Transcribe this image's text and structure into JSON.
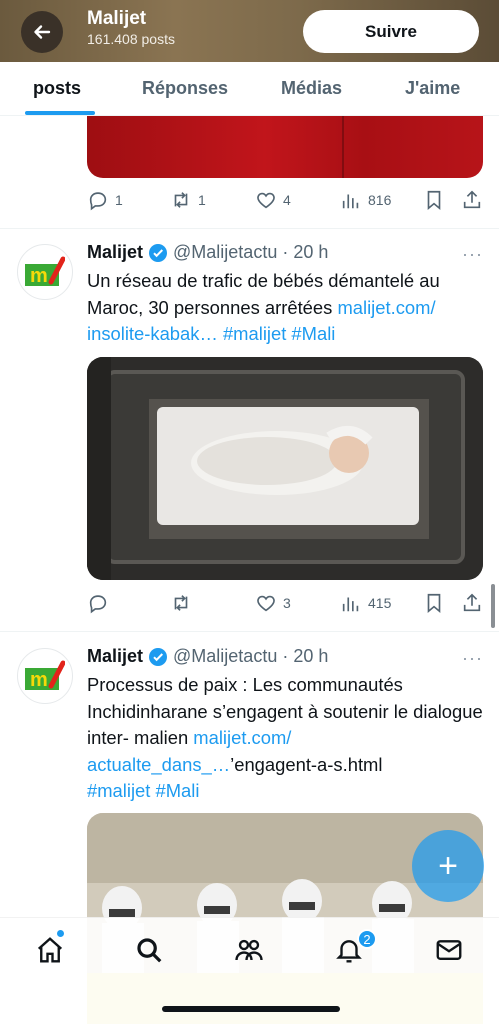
{
  "header": {
    "title": "Malijet",
    "subtitle": "161.408 posts",
    "follow_label": "Suivre"
  },
  "tabs": [
    {
      "label": "posts"
    },
    {
      "label": "Réponses"
    },
    {
      "label": "Médias"
    },
    {
      "label": "J'aime"
    }
  ],
  "post0": {
    "replies": "1",
    "reposts": "1",
    "likes": "4",
    "views": "816"
  },
  "post1": {
    "author": "Malijet",
    "handle": "@Malijetactu",
    "time": "· 20 h",
    "text": "Un réseau de trafic de bébés démantelé au Maroc, 30 personnes arrêtées ",
    "link1": "malijet.com/ insolite-kabak…",
    "tags": " #malijet #Mali",
    "replies": "",
    "reposts": "",
    "likes": "3",
    "views": "415"
  },
  "post2": {
    "author": "Malijet",
    "handle": "@Malijetactu",
    "time": "· 20 h",
    "text": "Processus de paix : Les communautés Inchidinharane s’engagent à soutenir le dialogue inter- malien ",
    "link1": "malijet.com/ actualte_dans_…",
    "text2": "’engagent-a-s.html",
    "tags": "#malijet #Mali"
  },
  "avatar_logo": "m",
  "more_glyph": "···",
  "notifications_badge": "2",
  "fab_glyph": "+",
  "colors": {
    "accent": "#1d9bf0",
    "text": "#0f1419",
    "muted": "#536471"
  }
}
